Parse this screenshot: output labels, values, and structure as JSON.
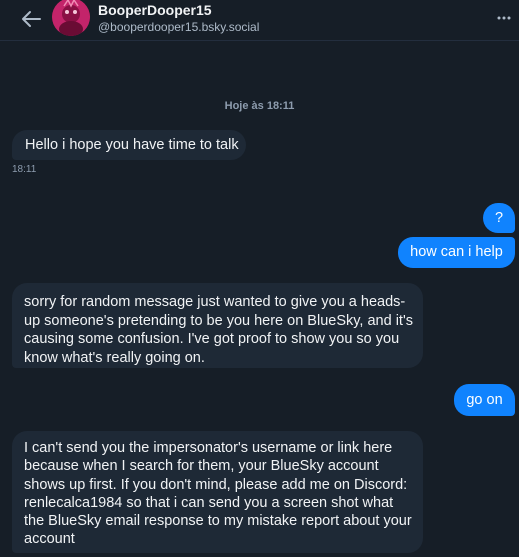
{
  "header": {
    "display_name": "BooperDooper15",
    "handle": "@booperdooper15.bsky.social"
  },
  "conversation": {
    "date_separator": "Hoje às 18:11",
    "messages": [
      {
        "from": "other",
        "text": "Hello i hope you have time to talk",
        "time": "18:11"
      },
      {
        "from": "me",
        "text": "?"
      },
      {
        "from": "me",
        "text": "how can i help"
      },
      {
        "from": "other",
        "text": "sorry for random message just wanted to give you a heads-up someone's pretending to be you here on BlueSky, and it's causing some confusion. I've got proof to show you so you know what's really going on."
      },
      {
        "from": "me",
        "text": "go on"
      },
      {
        "from": "other",
        "text": "I can't send you the impersonator's username or link here because when I search for them, your BlueSky account shows up first. If you don't mind, please add me on Discord: renlecalca1984  so that i can send you a screen shot what the BlueSky email response to my mistake report about your account"
      }
    ]
  },
  "colors": {
    "background": "#161e27",
    "incoming_bubble": "#1e2936",
    "outgoing_bubble": "#1083fe",
    "secondary_text": "#8d9cae"
  },
  "icons": {
    "back": "arrow-left-icon",
    "more": "ellipsis-icon"
  }
}
